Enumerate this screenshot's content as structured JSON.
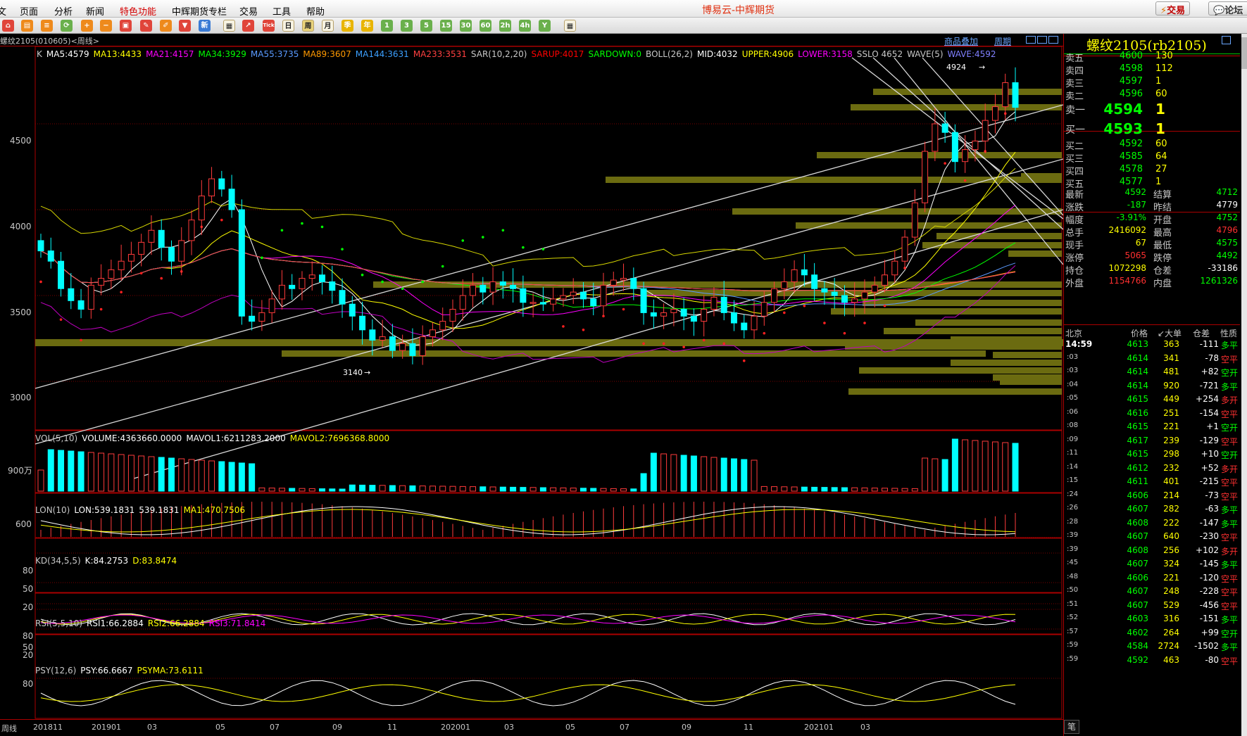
{
  "app": {
    "title": "博易云-中辉期货",
    "trade_button": "交易",
    "forum_button": "论坛",
    "icon_trade": "lightning-icon",
    "icon_forum": "chat-icon"
  },
  "menu": [
    "页面",
    "分析",
    "新闻",
    "特色功能",
    "中辉期货专栏",
    "交易",
    "工具",
    "帮助"
  ],
  "toolbar": {
    "period_buttons": [
      "日",
      "周",
      "月",
      "季",
      "年",
      "1",
      "3",
      "5",
      "15",
      "30",
      "60",
      "2h",
      "4h",
      "Y"
    ]
  },
  "chart": {
    "symbol_header": "螺纹2105(010605)<周线>",
    "overlay_label": "商品叠加",
    "period_label": "周期",
    "main_indicators": [
      {
        "text": "K",
        "color": "#c8c8c8"
      },
      {
        "text": "MA5:4579",
        "color": "#ffffff"
      },
      {
        "text": "MA13:4433",
        "color": "#ffff00"
      },
      {
        "text": "MA21:4157",
        "color": "#ff00ff"
      },
      {
        "text": "MA34:3929",
        "color": "#00ff00"
      },
      {
        "text": "MA55:3735",
        "color": "#5a9aff"
      },
      {
        "text": "MA89:3607",
        "color": "#ff9900"
      },
      {
        "text": "MA144:3631",
        "color": "#3ca0ff"
      },
      {
        "text": "MA233:3531",
        "color": "#ff4040"
      },
      {
        "text": "SAR(10,2,20)",
        "color": "#c8c8c8"
      },
      {
        "text": "SARUP:4017",
        "color": "#ff0000"
      },
      {
        "text": "SARDOWN:0",
        "color": "#00ff00"
      },
      {
        "text": "BOLL(26,2)",
        "color": "#c8c8c8"
      },
      {
        "text": "MID:4032",
        "color": "#ffffff"
      },
      {
        "text": "UPPER:4906",
        "color": "#ffff00"
      },
      {
        "text": "LOWER:3158",
        "color": "#ff00ff"
      },
      {
        "text": "SSLO 4652",
        "color": "#c8c8c8"
      },
      {
        "text": "WAVE(5)",
        "color": "#c8c8c8"
      },
      {
        "text": "WAVE:4592",
        "color": "#8080ff"
      }
    ],
    "y_ticks": [
      "4500",
      "4000",
      "3500",
      "3000"
    ],
    "annot_high": "4924",
    "annot_low": "3140",
    "vol_label": [
      {
        "text": "VOL(5,10)",
        "color": "#c8c8c8"
      },
      {
        "text": "VOLUME:4363660.0000",
        "color": "#ffffff"
      },
      {
        "text": "MAVOL1:6211283.2000",
        "color": "#ffffff"
      },
      {
        "text": "MAVOL2:7696368.8000",
        "color": "#ffff00"
      }
    ],
    "vol_tick": "900万",
    "lon_label": [
      {
        "text": "LON(10)",
        "color": "#c8c8c8"
      },
      {
        "text": "LON:539.1831",
        "color": "#ffffff"
      },
      {
        "text": "539.1831",
        "color": "#ffffff"
      },
      {
        "text": "MA1:470.7506",
        "color": "#ffff00"
      }
    ],
    "lon_tick": "600",
    "kd_label": [
      {
        "text": "KD(34,5,5)",
        "color": "#c8c8c8"
      },
      {
        "text": "K:84.2753",
        "color": "#ffffff"
      },
      {
        "text": "D:83.8474",
        "color": "#ffff00"
      }
    ],
    "kd_ticks": [
      "80",
      "50",
      "20"
    ],
    "rsi_label": [
      {
        "text": "RSI(5,5,10)",
        "color": "#c8c8c8"
      },
      {
        "text": "RSI1:66.2884",
        "color": "#ffffff"
      },
      {
        "text": "RSI2:66.2884",
        "color": "#ffff00"
      },
      {
        "text": "RSI3:71.8414",
        "color": "#ff00ff"
      }
    ],
    "rsi_ticks": [
      "80",
      "50",
      "20"
    ],
    "psy_label": [
      {
        "text": "PSY(12,6)",
        "color": "#c8c8c8"
      },
      {
        "text": "PSY:66.6667",
        "color": "#ffffff"
      },
      {
        "text": "PSYMA:73.6111",
        "color": "#ffff00"
      }
    ],
    "psy_tick": "80",
    "x_labels": [
      "周线",
      "201811",
      "201901",
      "03",
      "05",
      "07",
      "09",
      "11",
      "202001",
      "03",
      "05",
      "07",
      "09",
      "11",
      "202101",
      "03"
    ]
  },
  "quote": {
    "title": "螺纹2105(rb2105)",
    "asks": [
      {
        "label": "卖五",
        "price": "4600",
        "vol": "130"
      },
      {
        "label": "卖四",
        "price": "4598",
        "vol": "112"
      },
      {
        "label": "卖三",
        "price": "4597",
        "vol": "1"
      },
      {
        "label": "卖二",
        "price": "4596",
        "vol": "60"
      },
      {
        "label": "卖一",
        "price": "4594",
        "vol": "1"
      }
    ],
    "bids": [
      {
        "label": "买一",
        "price": "4593",
        "vol": "1"
      },
      {
        "label": "买二",
        "price": "4592",
        "vol": "60"
      },
      {
        "label": "买三",
        "price": "4585",
        "vol": "64"
      },
      {
        "label": "买四",
        "price": "4578",
        "vol": "27"
      },
      {
        "label": "买五",
        "price": "4577",
        "vol": "1"
      }
    ],
    "stats": [
      {
        "l1": "最新",
        "v1": "4592",
        "c1": "#00ff00",
        "l2": "结算",
        "v2": "4712",
        "c2": "#00ff00"
      },
      {
        "l1": "涨跌",
        "v1": "-187",
        "c1": "#00ff00",
        "l2": "昨结",
        "v2": "4779",
        "c2": "#ffffff"
      },
      {
        "l1": "幅度",
        "v1": "-3.91%",
        "c1": "#00ff00",
        "l2": "开盘",
        "v2": "4752",
        "c2": "#00ff00"
      },
      {
        "l1": "总手",
        "v1": "2416092",
        "c1": "#ffff00",
        "l2": "最高",
        "v2": "4796",
        "c2": "#ff3030"
      },
      {
        "l1": "现手",
        "v1": "67",
        "c1": "#ffff00",
        "l2": "最低",
        "v2": "4575",
        "c2": "#00ff00"
      },
      {
        "l1": "涨停",
        "v1": "5065",
        "c1": "#ff3030",
        "l2": "跌停",
        "v2": "4492",
        "c2": "#00ff00"
      },
      {
        "l1": "持仓",
        "v1": "1072298",
        "c1": "#ffff00",
        "l2": "仓差",
        "v2": "-33186",
        "c2": "#ffffff"
      },
      {
        "l1": "外盘",
        "v1": "1154766",
        "c1": "#ff3030",
        "l2": "内盘",
        "v2": "1261326",
        "c2": "#00ff00"
      }
    ],
    "tick_header": {
      "place": "北京",
      "price": "价格",
      "vol": "↙大单",
      "oi": "仓差",
      "nature": "性质"
    },
    "ticks": [
      {
        "t": "14:59",
        "p": "4613",
        "v": "363",
        "d": "-111",
        "n": "多平",
        "pc": "#00ff00",
        "nc": "#00ff00"
      },
      {
        "t": ":03",
        "p": "4614",
        "v": "341",
        "d": "-78",
        "n": "空平",
        "pc": "#00ff00",
        "nc": "#ff3030"
      },
      {
        "t": ":03",
        "p": "4614",
        "v": "481",
        "d": "+82",
        "n": "空开",
        "pc": "#00ff00",
        "nc": "#00ff00"
      },
      {
        "t": ":04",
        "p": "4614",
        "v": "920",
        "d": "-721",
        "n": "多平",
        "pc": "#00ff00",
        "nc": "#00ff00"
      },
      {
        "t": ":05",
        "p": "4615",
        "v": "449",
        "d": "+254",
        "n": "多开",
        "pc": "#00ff00",
        "nc": "#ff3030"
      },
      {
        "t": ":06",
        "p": "4616",
        "v": "251",
        "d": "-154",
        "n": "空平",
        "pc": "#00ff00",
        "nc": "#ff3030"
      },
      {
        "t": ":08",
        "p": "4615",
        "v": "221",
        "d": "+1",
        "n": "空开",
        "pc": "#00ff00",
        "nc": "#00ff00"
      },
      {
        "t": ":09",
        "p": "4617",
        "v": "239",
        "d": "-129",
        "n": "空平",
        "pc": "#00ff00",
        "nc": "#ff3030"
      },
      {
        "t": ":11",
        "p": "4615",
        "v": "298",
        "d": "+10",
        "n": "空开",
        "pc": "#00ff00",
        "nc": "#00ff00"
      },
      {
        "t": ":14",
        "p": "4612",
        "v": "232",
        "d": "+52",
        "n": "多开",
        "pc": "#00ff00",
        "nc": "#ff3030"
      },
      {
        "t": ":15",
        "p": "4611",
        "v": "401",
        "d": "-215",
        "n": "空平",
        "pc": "#00ff00",
        "nc": "#ff3030"
      },
      {
        "t": ":24",
        "p": "4606",
        "v": "214",
        "d": "-73",
        "n": "空平",
        "pc": "#00ff00",
        "nc": "#ff3030"
      },
      {
        "t": ":26",
        "p": "4607",
        "v": "282",
        "d": "-63",
        "n": "多平",
        "pc": "#00ff00",
        "nc": "#00ff00"
      },
      {
        "t": ":28",
        "p": "4608",
        "v": "222",
        "d": "-147",
        "n": "多平",
        "pc": "#00ff00",
        "nc": "#00ff00"
      },
      {
        "t": ":39",
        "p": "4607",
        "v": "640",
        "d": "-230",
        "n": "空平",
        "pc": "#00ff00",
        "nc": "#ff3030"
      },
      {
        "t": ":39",
        "p": "4608",
        "v": "256",
        "d": "+102",
        "n": "多开",
        "pc": "#00ff00",
        "nc": "#ff3030"
      },
      {
        "t": ":45",
        "p": "4607",
        "v": "324",
        "d": "-145",
        "n": "多平",
        "pc": "#00ff00",
        "nc": "#00ff00"
      },
      {
        "t": ":48",
        "p": "4606",
        "v": "221",
        "d": "-120",
        "n": "空平",
        "pc": "#00ff00",
        "nc": "#ff3030"
      },
      {
        "t": ":50",
        "p": "4607",
        "v": "248",
        "d": "-228",
        "n": "空平",
        "pc": "#00ff00",
        "nc": "#ff3030"
      },
      {
        "t": ":51",
        "p": "4607",
        "v": "529",
        "d": "-456",
        "n": "空平",
        "pc": "#00ff00",
        "nc": "#ff3030"
      },
      {
        "t": ":52",
        "p": "4603",
        "v": "316",
        "d": "-151",
        "n": "多平",
        "pc": "#00ff00",
        "nc": "#00ff00"
      },
      {
        "t": ":57",
        "p": "4602",
        "v": "264",
        "d": "+99",
        "n": "空开",
        "pc": "#00ff00",
        "nc": "#00ff00"
      },
      {
        "t": ":59",
        "p": "4584",
        "v": "2724",
        "d": "-1502",
        "n": "多平",
        "pc": "#00ff00",
        "nc": "#00ff00"
      },
      {
        "t": ":59",
        "p": "4592",
        "v": "463",
        "d": "-80",
        "n": "空平",
        "pc": "#00ff00",
        "nc": "#ff3030"
      }
    ],
    "bottom_tab": "笔"
  }
}
